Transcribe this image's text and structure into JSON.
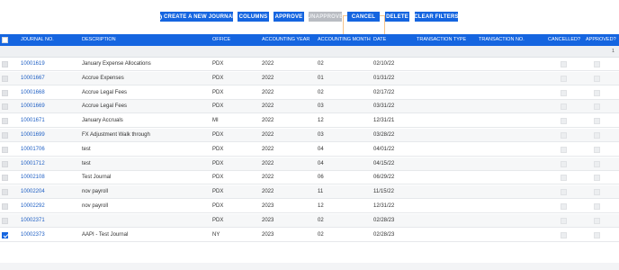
{
  "toolbar": {
    "create_label": "CREATE A NEW JOURNAL",
    "columns_label": "COLUMNS",
    "approve_label": "APPROVE",
    "unapprove_label": "UNAPPROVE",
    "cancel_label": "CANCEL",
    "delete_label": "DELETE",
    "clear_filters_label": "CLEAR FILTERS"
  },
  "grid": {
    "headers": {
      "journal_no": "JOURNAL NO.",
      "description": "DESCRIPTION",
      "office": "OFFICE",
      "accounting_year": "ACCOUNTING YEAR",
      "accounting_month": "ACCOUNTING MONTH",
      "date": "DATE",
      "transaction_type": "TRANSACTION TYPE",
      "transaction_no": "TRANSACTION NO.",
      "cancelled": "CANCELLED?",
      "approved": "APPROVED?"
    },
    "filter_count": "1",
    "rows": [
      {
        "journal_no": "10001619",
        "description": "January Expense Allocations",
        "office": "PDX",
        "year": "2022",
        "month": "02",
        "date": "02/10/22",
        "selected": false
      },
      {
        "journal_no": "10001667",
        "description": "Accrue Expenses",
        "office": "PDX",
        "year": "2022",
        "month": "01",
        "date": "01/31/22",
        "selected": false
      },
      {
        "journal_no": "10001668",
        "description": "Accrue Legal Fees",
        "office": "PDX",
        "year": "2022",
        "month": "02",
        "date": "02/17/22",
        "selected": false
      },
      {
        "journal_no": "10001669",
        "description": "Accrue Legal Fees",
        "office": "PDX",
        "year": "2022",
        "month": "03",
        "date": "03/31/22",
        "selected": false
      },
      {
        "journal_no": "10001671",
        "description": "January Accruals",
        "office": "MI",
        "year": "2022",
        "month": "12",
        "date": "12/31/21",
        "selected": false
      },
      {
        "journal_no": "10001699",
        "description": "FX Adjustment Walk through",
        "office": "PDX",
        "year": "2022",
        "month": "03",
        "date": "03/28/22",
        "selected": false
      },
      {
        "journal_no": "10001706",
        "description": "test",
        "office": "PDX",
        "year": "2022",
        "month": "04",
        "date": "04/01/22",
        "selected": false
      },
      {
        "journal_no": "10001712",
        "description": "test",
        "office": "PDX",
        "year": "2022",
        "month": "04",
        "date": "04/15/22",
        "selected": false
      },
      {
        "journal_no": "10002108",
        "description": "Test Journal",
        "office": "PDX",
        "year": "2022",
        "month": "06",
        "date": "06/29/22",
        "selected": false
      },
      {
        "journal_no": "10002204",
        "description": "nov payroll",
        "office": "PDX",
        "year": "2022",
        "month": "11",
        "date": "11/15/22",
        "selected": false
      },
      {
        "journal_no": "10002292",
        "description": "nov payroll",
        "office": "PDX",
        "year": "2023",
        "month": "12",
        "date": "12/31/22",
        "selected": false
      },
      {
        "journal_no": "10002371",
        "description": "",
        "office": "PDX",
        "year": "2023",
        "month": "02",
        "date": "02/28/23",
        "selected": false
      },
      {
        "journal_no": "10002373",
        "description": "AAPI - Test Journal",
        "office": "NY",
        "year": "2023",
        "month": "02",
        "date": "02/28/23",
        "selected": true
      }
    ]
  },
  "colors": {
    "accent": "#1565e0",
    "disabled": "#b9bcc2",
    "link": "#1e5fc4",
    "focus_outline": "#f5c38a"
  }
}
